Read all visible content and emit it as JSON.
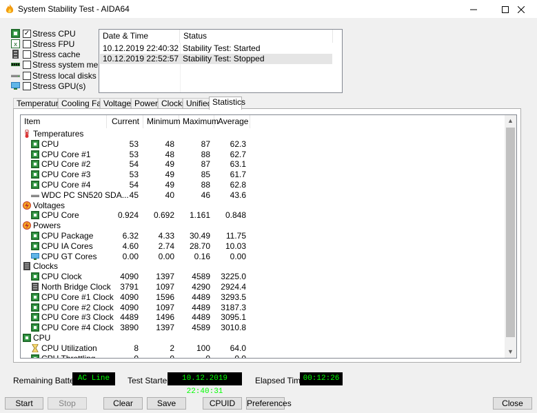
{
  "window": {
    "title": "System Stability Test - AIDA64",
    "controls": [
      "minimize-icon",
      "maximize-icon",
      "close-icon"
    ]
  },
  "stress_options": [
    {
      "label": "Stress CPU",
      "checked": true,
      "icon": "cpu-chip-icon"
    },
    {
      "label": "Stress FPU",
      "checked": false,
      "icon": "fpu-icon"
    },
    {
      "label": "Stress cache",
      "checked": false,
      "icon": "cache-icon"
    },
    {
      "label": "Stress system memory",
      "checked": false,
      "icon": "memory-icon"
    },
    {
      "label": "Stress local disks",
      "checked": false,
      "icon": "disk-icon"
    },
    {
      "label": "Stress GPU(s)",
      "checked": false,
      "icon": "gpu-icon"
    }
  ],
  "log": {
    "columns": [
      "Date & Time",
      "Status"
    ],
    "rows": [
      {
        "time": "10.12.2019 22:40:32",
        "status": "Stability Test: Started"
      },
      {
        "time": "10.12.2019 22:52:57",
        "status": "Stability Test: Stopped"
      }
    ]
  },
  "tabs": [
    "Temperatures",
    "Cooling Fans",
    "Voltages",
    "Powers",
    "Clocks",
    "Unified",
    "Statistics"
  ],
  "active_tab": "Statistics",
  "stats": {
    "columns": [
      "Item",
      "Current",
      "Minimum",
      "Maximum",
      "Average"
    ],
    "rows": [
      {
        "kind": "group",
        "label": "Temperatures",
        "icon": "thermometer-icon"
      },
      {
        "kind": "item",
        "label": "CPU",
        "icon": "cpu-chip-icon",
        "cur": "53",
        "min": "48",
        "max": "87",
        "avg": "62.3"
      },
      {
        "kind": "item",
        "label": "CPU Core #1",
        "icon": "cpu-chip-icon",
        "cur": "53",
        "min": "48",
        "max": "88",
        "avg": "62.7"
      },
      {
        "kind": "item",
        "label": "CPU Core #2",
        "icon": "cpu-chip-icon",
        "cur": "54",
        "min": "49",
        "max": "87",
        "avg": "63.1"
      },
      {
        "kind": "item",
        "label": "CPU Core #3",
        "icon": "cpu-chip-icon",
        "cur": "53",
        "min": "49",
        "max": "85",
        "avg": "61.7"
      },
      {
        "kind": "item",
        "label": "CPU Core #4",
        "icon": "cpu-chip-icon",
        "cur": "54",
        "min": "49",
        "max": "88",
        "avg": "62.8"
      },
      {
        "kind": "item",
        "label": "WDC PC SN520 SDA...",
        "icon": "disk-icon",
        "cur": "45",
        "min": "40",
        "max": "46",
        "avg": "43.6"
      },
      {
        "kind": "group",
        "label": "Voltages",
        "icon": "voltage-icon"
      },
      {
        "kind": "item",
        "label": "CPU Core",
        "icon": "cpu-chip-icon",
        "cur": "0.924",
        "min": "0.692",
        "max": "1.161",
        "avg": "0.848"
      },
      {
        "kind": "group",
        "label": "Powers",
        "icon": "power-icon"
      },
      {
        "kind": "item",
        "label": "CPU Package",
        "icon": "cpu-chip-icon",
        "cur": "6.32",
        "min": "4.33",
        "max": "30.49",
        "avg": "11.75"
      },
      {
        "kind": "item",
        "label": "CPU IA Cores",
        "icon": "cpu-chip-icon",
        "cur": "4.60",
        "min": "2.74",
        "max": "28.70",
        "avg": "10.03"
      },
      {
        "kind": "item",
        "label": "CPU GT Cores",
        "icon": "gpu-icon",
        "cur": "0.00",
        "min": "0.00",
        "max": "0.16",
        "avg": "0.00"
      },
      {
        "kind": "group",
        "label": "Clocks",
        "icon": "clocks-icon"
      },
      {
        "kind": "item",
        "label": "CPU Clock",
        "icon": "cpu-chip-icon",
        "cur": "4090",
        "min": "1397",
        "max": "4589",
        "avg": "3225.0"
      },
      {
        "kind": "item",
        "label": "North Bridge Clock",
        "icon": "northbridge-icon",
        "cur": "3791",
        "min": "1097",
        "max": "4290",
        "avg": "2924.4"
      },
      {
        "kind": "item",
        "label": "CPU Core #1 Clock",
        "icon": "cpu-chip-icon",
        "cur": "4090",
        "min": "1596",
        "max": "4489",
        "avg": "3293.5"
      },
      {
        "kind": "item",
        "label": "CPU Core #2 Clock",
        "icon": "cpu-chip-icon",
        "cur": "4090",
        "min": "1097",
        "max": "4489",
        "avg": "3187.3"
      },
      {
        "kind": "item",
        "label": "CPU Core #3 Clock",
        "icon": "cpu-chip-icon",
        "cur": "4489",
        "min": "1496",
        "max": "4489",
        "avg": "3095.1"
      },
      {
        "kind": "item",
        "label": "CPU Core #4 Clock",
        "icon": "cpu-chip-icon",
        "cur": "3890",
        "min": "1397",
        "max": "4589",
        "avg": "3010.8"
      },
      {
        "kind": "group",
        "label": "CPU",
        "icon": "cpu-chip-icon"
      },
      {
        "kind": "item",
        "label": "CPU Utilization",
        "icon": "hourglass-icon",
        "cur": "8",
        "min": "2",
        "max": "100",
        "avg": "64.0"
      },
      {
        "kind": "item",
        "label": "CPU Throttling",
        "icon": "cpu-chip-icon",
        "cur": "0",
        "min": "0",
        "max": "0",
        "avg": "0.0"
      }
    ]
  },
  "status": {
    "battery_label": "Remaining Battery:",
    "battery_value": "AC Line",
    "started_label": "Test Started:",
    "started_value": "10.12.2019 22:40:31",
    "elapsed_label": "Elapsed Time:",
    "elapsed_value": "00:12:26"
  },
  "buttons": {
    "start": "Start",
    "stop": "Stop",
    "clear": "Clear",
    "save": "Save",
    "cpuid": "CPUID",
    "preferences": "Preferences",
    "close": "Close"
  },
  "colors": {
    "status_bg": "#000000",
    "status_text": "#00ff00",
    "selection": "#e5e5e5"
  }
}
